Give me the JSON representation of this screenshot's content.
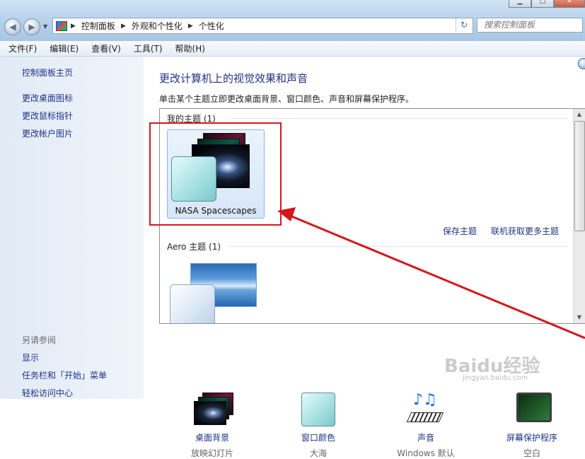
{
  "window": {
    "controls": {
      "minimize": "▁",
      "maximize": "□",
      "close": "✕"
    }
  },
  "nav": {
    "back_glyph": "◀",
    "forward_glyph": "▶",
    "history_glyph": "▼"
  },
  "address": {
    "icon": "control-panel-icon",
    "crumbs": [
      "控制面板",
      "外观和个性化",
      "个性化"
    ],
    "separator": "▶",
    "dropdown_glyph": "▼",
    "refresh_glyph": "↻"
  },
  "search": {
    "placeholder": "搜索控制面板"
  },
  "menu": [
    "文件(F)",
    "编辑(E)",
    "查看(V)",
    "工具(T)",
    "帮助(H)"
  ],
  "left_pane": {
    "links": [
      "控制面板主页",
      "更改桌面图标",
      "更改鼠标指针",
      "更改帐户图片"
    ],
    "see_also": "另请参阅",
    "see_also_links": [
      "显示",
      "任务栏和「开始」菜单",
      "轻松访问中心"
    ]
  },
  "main": {
    "heading": "更改计算机上的视觉效果和声音",
    "subtext": "单击某个主题立即更改桌面背景、窗口颜色、声音和屏幕保护程序。",
    "my_themes_label": "我的主题 (1)",
    "selected_theme": "NASA Spacescapes",
    "save_theme": "保存主题",
    "more_online": "联机获取更多主题",
    "aero_label": "Aero 主题 (1)"
  },
  "bottom": [
    {
      "label": "桌面背景",
      "sub": "放映幻灯片",
      "icon": "desktop-background-icon"
    },
    {
      "label": "窗口颜色",
      "sub": "大海",
      "icon": "window-color-icon"
    },
    {
      "label": "声音",
      "sub": "Windows 默认",
      "icon": "sound-icon"
    },
    {
      "label": "屏幕保护程序",
      "sub": "空白",
      "icon": "screensaver-icon"
    }
  ],
  "watermark": {
    "text": "Baidu经验",
    "sub": "jingyan.baidu.com"
  },
  "colors": {
    "link": "#1e3287",
    "highlight_box": "#d4171b",
    "arrow": "#d4171b"
  }
}
